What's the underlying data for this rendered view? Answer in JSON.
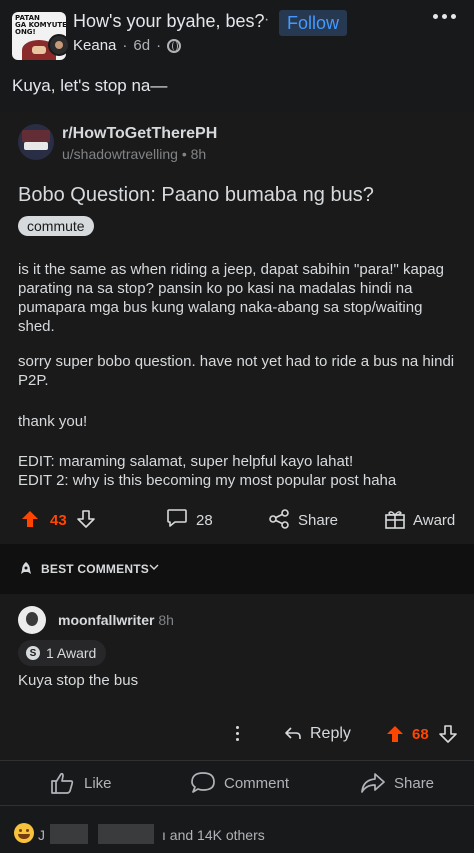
{
  "header": {
    "group_avatar_text": "PATAN\nGA KOMYUTER\nONG!",
    "group_name": "How's your byahe, bes?",
    "separator": "·",
    "follow_label": "Follow",
    "author": "Keana",
    "meta_sep": "·",
    "age": "6d",
    "meta_sep2": "·"
  },
  "caption": "Kuya, let's stop na—",
  "reddit": {
    "subreddit": "r/HowToGetTherePH",
    "user_line": "u/shadowtravelling • 8h",
    "title": "Bobo Question: Paano bumaba ng bus?",
    "flair": "commute",
    "body": [
      "is it the same as when riding a jeep, dapat sabihin \"para!\" kapag parating na sa stop? pansin ko po kasi na madalas hindi na pumapara mga bus kung walang naka-abang sa stop/waiting shed.",
      "sorry super bobo question. have not yet had to ride a bus na hindi P2P.",
      "thank you!",
      "EDIT: maraming salamat, super helpful kayo lahat!\nEDIT 2: why is this becoming my most popular post haha"
    ],
    "votes": "43",
    "comments": "28",
    "share_label": "Share",
    "award_label": "Award",
    "best_comments_label": "BEST COMMENTS",
    "comment": {
      "username": "moonfallwriter",
      "time": "8h",
      "award_icon_text": "S",
      "award_text": "1 Award",
      "text": "Kuya stop the bus",
      "reply_label": "Reply",
      "votes": "68"
    }
  },
  "footer": {
    "like_label": "Like",
    "comment_label": "Comment",
    "share_label": "Share",
    "react_prefix": "J",
    "react_text": "ı and 14K others"
  },
  "colors": {
    "background": "#18191a",
    "reddit_bg": "#1a1a1b",
    "upvote": "#ff4500",
    "follow_text": "#4599ff",
    "follow_bg": "#263951"
  }
}
